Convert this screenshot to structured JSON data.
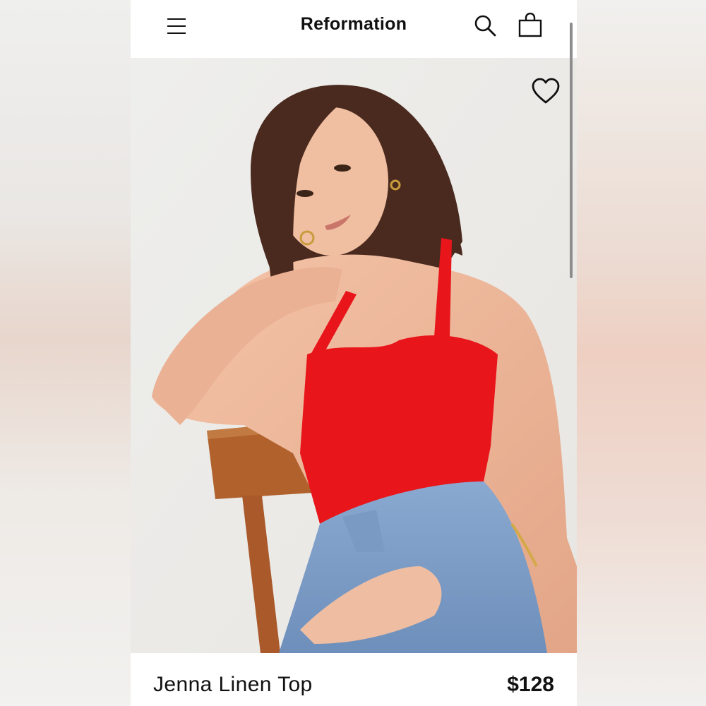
{
  "header": {
    "brand": "Reformation",
    "menu_icon": "hamburger-menu-icon",
    "search_icon": "search-icon",
    "bag_icon": "shopping-bag-icon"
  },
  "product": {
    "name": "Jenna Linen Top",
    "price": "$128",
    "wishlist_icon": "heart-icon",
    "image_alt": "Model wearing red halter linen top and blue jeans seated on wooden chair"
  },
  "colors": {
    "top_red": "#e8151b",
    "denim": "#7f9fc7",
    "chair_wood": "#b0612c",
    "text": "#111111"
  }
}
